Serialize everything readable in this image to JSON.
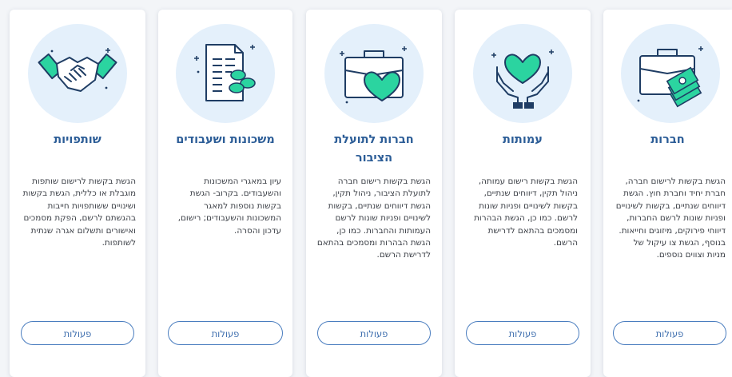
{
  "cards": [
    {
      "id": "partnerships",
      "title": "שותפויות",
      "description": "הגשת בקשות לרישום שותפות מוגבלת או כללית, הגשת בקשות ושינויים ששותפויות חייבות בהגשתם לרשם, הפקת מסמכים ואישורים ותשלום אגרה שנתית לשותפות.",
      "button_label": "פעולות",
      "icon": "handshake-icon"
    },
    {
      "id": "liens",
      "title": "משכונות ושעבודים",
      "description": "עיון במאגרי המשכונות והשעבודים. בקרוב- הגשת בקשות נוספות למאגר המשכונות והשעבודים; רישום, עדכון והסרה.",
      "button_label": "פעולות",
      "icon": "document-coins-icon"
    },
    {
      "id": "public-benefit",
      "title": "חברות לתועלת הציבור",
      "description": "הגשת בקשות רישום חברה לתועלת הציבור, ניהול תקין, הגשת דיווחים שנתיים, בקשות לשינויים ופניות שונות לרשם העמותות והחברות. כמו כן, הגשת הבהרות ומסמכים בהתאם לדרישת הרשם.",
      "button_label": "פעולות",
      "icon": "briefcase-heart-icon"
    },
    {
      "id": "associations",
      "title": "עמותות",
      "description": "הגשת בקשות רישום עמותה, ניהול תקין, דיווחים שנתיים, בקשות לשינויים ופניות שונות לרשם. כמו כן, הגשת הבהרות ומסמכים בהתאם לדרישת הרשם.",
      "button_label": "פעולות",
      "icon": "hands-heart-icon"
    },
    {
      "id": "companies",
      "title": "חברות",
      "description": "הגשת בקשות לרישום חברה, חברת יחיד וחברת חוץ. הגשת דיווחים שנתיים, בקשות לשינויים ופניות שונות לרשם החברות, דיווחי פירוקים, מיזוגים וחייאות. בנוסף, הגשת צו עיקול של מניות וצווים נוספים.",
      "button_label": "פעולות",
      "icon": "briefcase-money-icon"
    }
  ],
  "colors": {
    "title": "#2c5d97",
    "icon_circle": "#e4f0fb",
    "icon_stroke": "#1f3d64",
    "icon_accent": "#2bd4a0",
    "button_border": "#4a7dbf"
  }
}
